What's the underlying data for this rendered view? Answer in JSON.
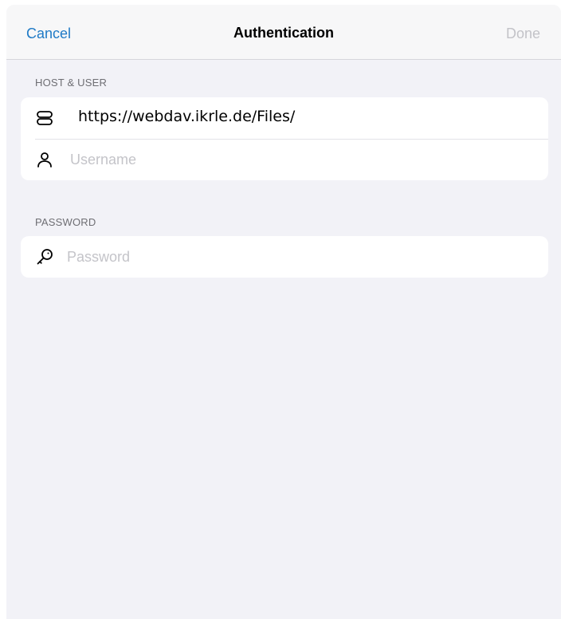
{
  "navbar": {
    "cancel_label": "Cancel",
    "title": "Authentication",
    "done_label": "Done"
  },
  "sections": {
    "host_user": {
      "header": "HOST & USER",
      "host_value": "https://webdav.ikrle.de/Files/",
      "host_icon": "server-icon",
      "username_placeholder": "Username",
      "username_icon": "person-icon"
    },
    "password": {
      "header": "PASSWORD",
      "password_placeholder": "Password",
      "password_icon": "key-icon"
    }
  },
  "colors": {
    "accent": "#1f7ac6",
    "disabled": "#c3c3c8",
    "background": "#f2f2f7",
    "placeholder": "#c4c4c9"
  }
}
